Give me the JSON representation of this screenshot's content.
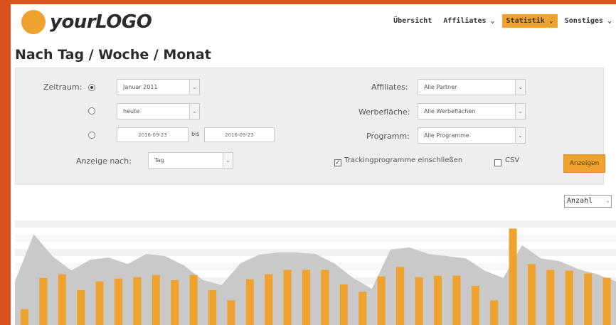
{
  "header": {
    "logo_text": "yourLOGO",
    "nav": [
      {
        "label": "Übersicht",
        "active": false
      },
      {
        "label": "Affiliates ⌄",
        "active": false
      },
      {
        "label": "Statistik ⌄",
        "active": true
      },
      {
        "label": "Sonstiges ⌄",
        "active": false
      }
    ]
  },
  "page_title": "Nach Tag / Woche / Monat",
  "filters": {
    "zeitraum_label": "Zeitraum:",
    "month_select": "Januar 2011",
    "day_select": "heute",
    "date_from": "2016-09-23",
    "bis_label": "bis",
    "date_to": "2016-09-23",
    "anzeige_label": "Anzeige nach:",
    "anzeige_value": "Tag",
    "affiliates_label": "Affiliates:",
    "affiliates_value": "Alle Partner",
    "werbeflaeche_label": "Werbefläche:",
    "werbeflaeche_value": "Alle Werbeflächen",
    "programm_label": "Programm:",
    "programm_value": "Alle Programme",
    "tracking_label": "Trackingprogramme einschließen",
    "csv_label": "CSV",
    "submit_label": "Anzeigen"
  },
  "metric_select": "Anzahl",
  "colors": {
    "accent": "#f0a22e",
    "area": "#c9c9c9",
    "frame": "#d9531e"
  },
  "chart_data": {
    "type": "bar",
    "values": [
      22,
      65,
      70,
      48,
      60,
      64,
      66,
      69,
      62,
      69,
      48,
      34,
      63,
      70,
      76,
      76,
      76,
      56,
      46,
      67,
      80,
      66,
      68,
      68,
      54,
      34,
      133,
      84,
      76,
      75,
      71,
      65
    ],
    "area_values": [
      60,
      125,
      95,
      75,
      90,
      93,
      84,
      98,
      95,
      82,
      62,
      55,
      85,
      97,
      100,
      100,
      98,
      85,
      65,
      50,
      104,
      107,
      98,
      95,
      92,
      75,
      65,
      110,
      92,
      88,
      77,
      70,
      60
    ],
    "ylim": [
      0,
      150
    ]
  }
}
